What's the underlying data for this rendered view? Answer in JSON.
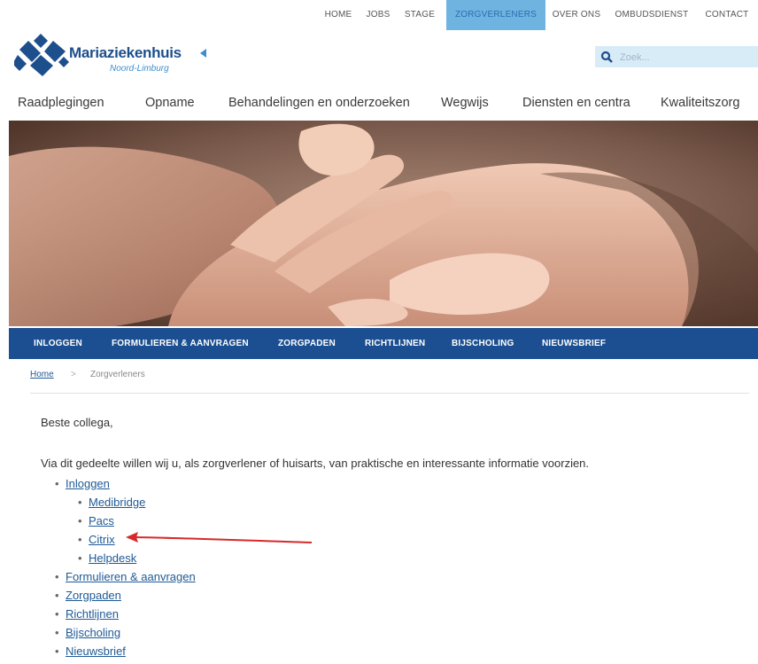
{
  "top_nav": {
    "items": [
      "HOME",
      "JOBS",
      "STAGE",
      "ZORGVERLENERS",
      "OVER ONS",
      "OMBUDSDIENST",
      "CONTACT"
    ],
    "active_index": 3
  },
  "logo": {
    "name": "Mariaziekenhuis",
    "subtitle": "Noord-Limburg"
  },
  "search": {
    "placeholder": "Zoek..."
  },
  "main_nav": {
    "items": [
      "Raadplegingen",
      "Opname",
      "Behandelingen en onderzoeken",
      "Wegwijs",
      "Diensten en centra",
      "Kwaliteitszorg"
    ]
  },
  "sub_nav": {
    "items": [
      "INLOGGEN",
      "FORMULIEREN & AANVRAGEN",
      "ZORGPADEN",
      "RICHTLIJNEN",
      "BIJSCHOLING",
      "NIEUWSBRIEF"
    ]
  },
  "breadcrumb": {
    "home": "Home",
    "separator": ">",
    "current": "Zorgverleners"
  },
  "content": {
    "greeting": "Beste collega,",
    "intro": "Via dit gedeelte willen wij u, als zorgverlener of huisarts, van praktische en interessante informatie voorzien.",
    "links": {
      "inloggen": "Inloggen",
      "inloggen_children": [
        "Medibridge",
        "Pacs",
        "Citrix",
        "Helpdesk"
      ],
      "others": [
        "Formulieren & aanvragen",
        "Zorgpaden",
        "Richtlijnen",
        "Bijscholing",
        "Nieuwsbrief"
      ]
    },
    "bullet": "•"
  },
  "colors": {
    "brand_blue": "#1c4f91",
    "active_tab": "#6fb4e0",
    "link": "#1f5a96",
    "annotation_arrow": "#d62a2a"
  }
}
